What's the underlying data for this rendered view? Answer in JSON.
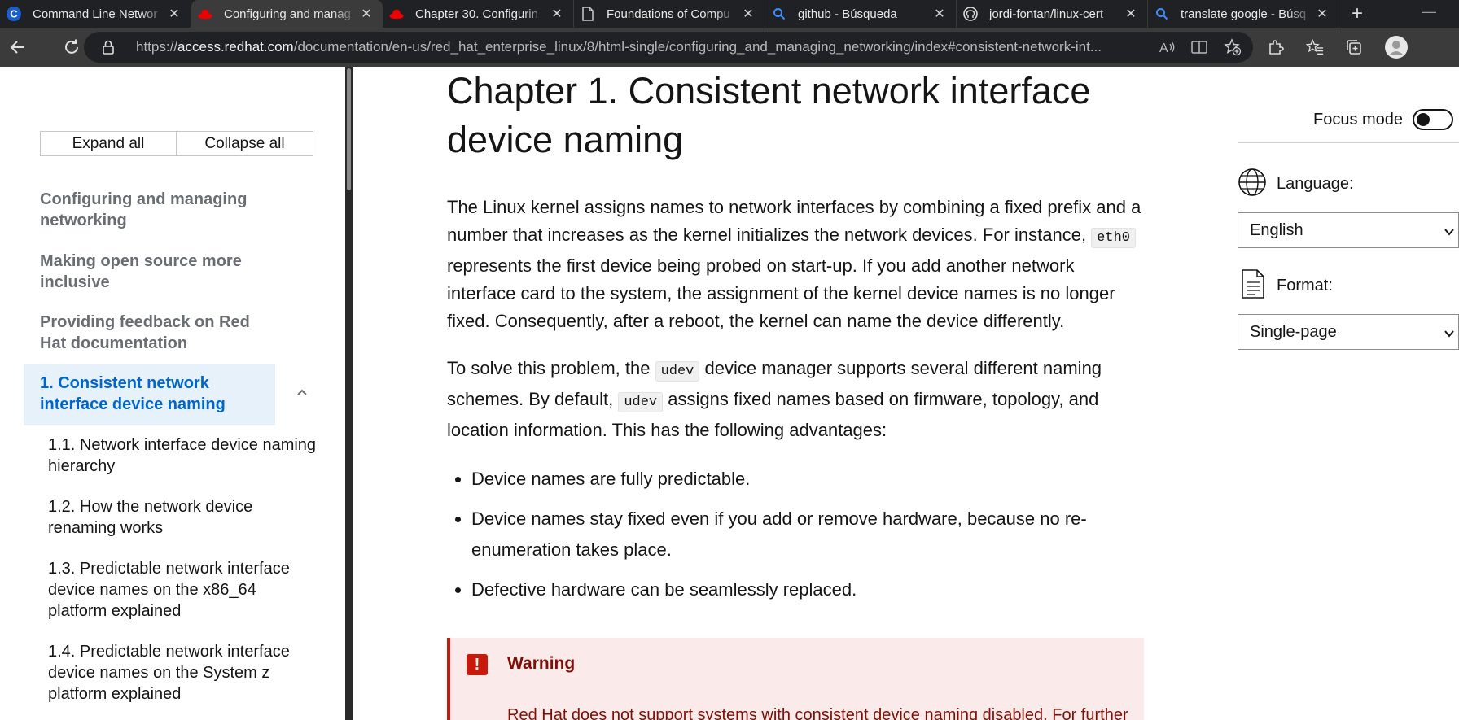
{
  "browser": {
    "tabs": [
      {
        "title": "Command Line Networ",
        "icon": "c-logo-icon",
        "active": false
      },
      {
        "title": "Configuring and manag",
        "icon": "redhat-icon",
        "active": true
      },
      {
        "title": "Chapter 30. Configurin",
        "icon": "redhat-icon",
        "active": false
      },
      {
        "title": "Foundations of Compu",
        "icon": "document-icon",
        "active": false
      },
      {
        "title": "github - Búsqueda",
        "icon": "search-icon",
        "active": false
      },
      {
        "title": "jordi-fontan/linux-cert",
        "icon": "github-icon",
        "active": false
      },
      {
        "title": "translate google - Búsq",
        "icon": "search-icon",
        "active": false
      }
    ],
    "url_prefix": "https://",
    "url_host": "access.redhat.com",
    "url_path": "/documentation/en-us/red_hat_enterprise_linux/8/html-single/configuring_and_managing_networking/index#consistent-network-int..."
  },
  "sidebar": {
    "expand_all": "Expand all",
    "collapse_all": "Collapse all",
    "items": [
      "Configuring and managing networking",
      "Making open source more inclusive",
      "Providing feedback on Red Hat documentation"
    ],
    "current": "1. Consistent network interface device naming",
    "subitems": [
      "1.1. Network interface device naming hierarchy",
      "1.2. How the network device renaming works",
      "1.3. Predictable network interface device names on the x86_64 platform explained",
      "1.4. Predictable network interface device names on the System z platform explained"
    ]
  },
  "content": {
    "title": "Chapter 1. Consistent network interface device naming",
    "p1_a": "The Linux kernel assigns names to network interfaces by combining a fixed prefix and a number that increases as the kernel initializes the network devices. For instance, ",
    "p1_code": "eth0",
    "p1_b": " represents the first device being probed on start-up. If you add another network interface card to the system, the assignment of the kernel device names is no longer fixed. Consequently, after a reboot, the kernel can name the device differently.",
    "p2_a": "To solve this problem, the ",
    "p2_code1": "udev",
    "p2_b": " device manager supports several different naming schemes. By default, ",
    "p2_code2": "udev",
    "p2_c": " assigns fixed names based on firmware, topology, and location information. This has the following advantages:",
    "bullets": [
      "Device names are fully predictable.",
      "Device names stay fixed even if you add or remove hardware, because no re-enumeration takes place.",
      "Defective hardware can be seamlessly replaced."
    ],
    "warning_title": "Warning",
    "warning_text": "Red Hat does not support systems with consistent device naming disabled. For further"
  },
  "right": {
    "focus_mode": "Focus mode",
    "language_label": "Language:",
    "language_value": "English",
    "format_label": "Format:",
    "format_value": "Single-page"
  }
}
